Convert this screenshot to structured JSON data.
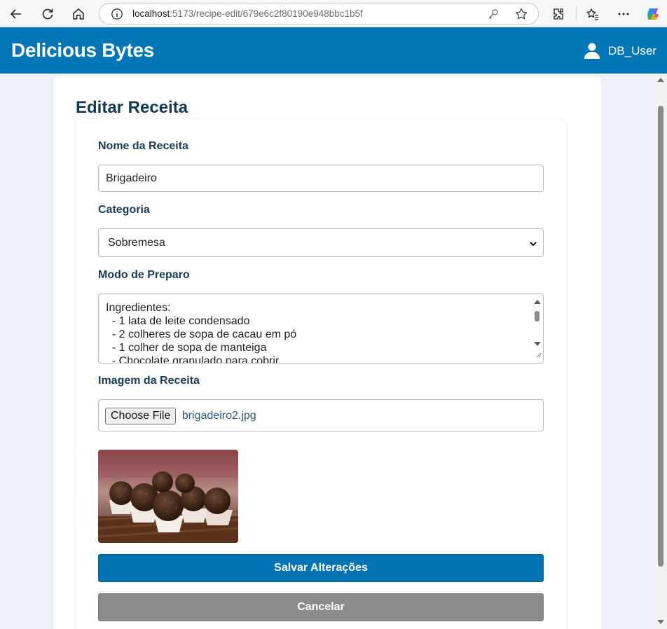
{
  "browser": {
    "url_host": "localhost",
    "url_rest": ":5173/recipe-edit/679e6c2f80190e948bbc1b5f"
  },
  "header": {
    "brand": "Delicious Bytes",
    "username": "DB_User"
  },
  "form": {
    "title": "Editar Receita",
    "name_label": "Nome da Receita",
    "name_value": "Brigadeiro",
    "category_label": "Categoria",
    "category_value": "Sobremesa",
    "method_label": "Modo de Preparo",
    "method_lines": [
      "Ingredientes:",
      "  - 1 lata de leite condensado",
      "  - 2 colheres de sopa de cacau em pó",
      "  - 1 colher de sopa de manteiga",
      "  - Chocolate granulado para cobrir"
    ],
    "image_label": "Imagem da Receita",
    "choose_file_label": "Choose File",
    "file_name": "brigadeiro2.jpg",
    "save_label": "Salvar Alterações",
    "cancel_label": "Cancelar"
  },
  "colors": {
    "brand_blue": "#0276b6",
    "cancel_gray": "#8b8b8b"
  }
}
